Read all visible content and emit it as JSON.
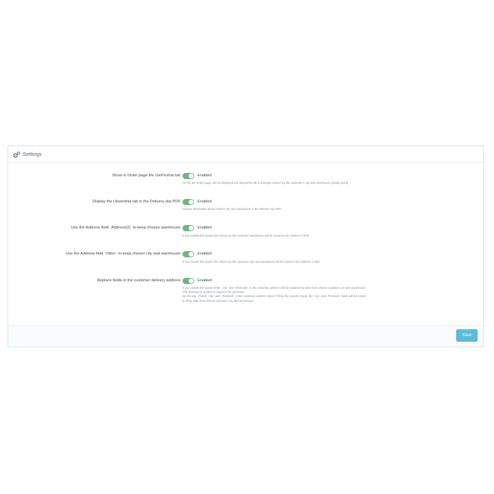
{
  "panel": {
    "title": "Settings",
    "icon": "gears-icon"
  },
  "fields": [
    {
      "label": "Show in Order page the UkrPoshta tab",
      "toggle": "Enabled",
      "help": [
        "On the BO order page, will be displayed the Ukrposhta tab to manage chosen by the customer's city and warehouse (pickup point)."
      ]
    },
    {
      "label": "Display the Ukrposhta tab in the Delivery slip PDF",
      "toggle": "Enabled",
      "help": [
        "Display information about chosen city and warehouse in the Delivery slip PDF"
      ]
    },
    {
      "label": "Use the Address field `Address(2)` to keep chosen warehouse",
      "toggle": "Enabled",
      "help": [
        "If you enable this option the chosen by the customer warehouse will be saved to the Address 2 field"
      ]
    },
    {
      "label": "Use the Address field `Other` to keep chosen city and warehouse",
      "toggle": "Enabled",
      "help": [
        "If you enable this option the chosen by the customer city and warehouse will be saved to the Address 2 field"
      ]
    },
    {
      "label": "Replace fields in the customer delivery address",
      "toggle": "Enabled",
      "help": [
        "If you enable this option fields `City` and `Postcode` in the customer address will be replaced by data from chosen customer city and warehouse.",
        "The warehouse number is equal to the postcode.",
        "By the way, if fields `City` and `Postcode` in the customer address doesn't fill by the pseudo empty, the `City` and `Postcode` fields will be forced",
        "to fill by data from chosen customer city and warehouse."
      ]
    }
  ],
  "footer": {
    "save_label": "Save"
  },
  "colors": {
    "toggle_on": "#70b580",
    "save_button": "#5ebbd7"
  }
}
